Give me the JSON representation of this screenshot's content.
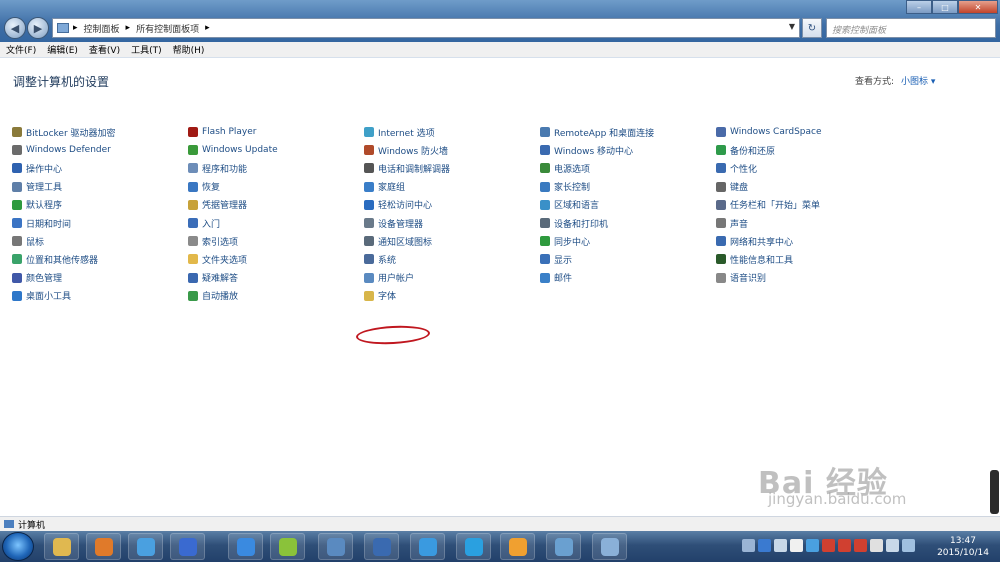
{
  "window": {
    "breadcrumb": [
      "控制面板",
      "所有控制面板项"
    ],
    "search_placeholder": "搜索控制面板",
    "buttons": {
      "minimize": "–",
      "maximize": "□",
      "close": "✕"
    }
  },
  "menu": [
    "文件(F)",
    "编辑(E)",
    "查看(V)",
    "工具(T)",
    "帮助(H)"
  ],
  "page": {
    "title": "调整计算机的设置",
    "view_by_label": "查看方式:",
    "view_by_value": "小图标 ▾"
  },
  "columns": [
    {
      "items": [
        {
          "label": "BitLocker 驱动器加密",
          "icon": "bitlocker-icon",
          "color": "#8a7a3a"
        },
        {
          "label": "Windows Defender",
          "icon": "defender-icon",
          "color": "#6b6b6b"
        },
        {
          "label": "操作中心",
          "icon": "flag-icon",
          "color": "#2f62b0"
        },
        {
          "label": "管理工具",
          "icon": "admin-tools-icon",
          "color": "#5f7fa8"
        },
        {
          "label": "默认程序",
          "icon": "default-programs-icon",
          "color": "#2e9a3e"
        },
        {
          "label": "日期和时间",
          "icon": "clock-icon",
          "color": "#3b74c4"
        },
        {
          "label": "鼠标",
          "icon": "mouse-icon",
          "color": "#777"
        },
        {
          "label": "位置和其他传感器",
          "icon": "sensor-icon",
          "color": "#3aa36a"
        },
        {
          "label": "颜色管理",
          "icon": "color-icon",
          "color": "#4058a8"
        },
        {
          "label": "桌面小工具",
          "icon": "gadgets-icon",
          "color": "#2e77c9"
        }
      ]
    },
    {
      "items": [
        {
          "label": "Flash Player",
          "icon": "flash-icon",
          "color": "#a01a14"
        },
        {
          "label": "Windows Update",
          "icon": "update-icon",
          "color": "#3a9a3a"
        },
        {
          "label": "程序和功能",
          "icon": "programs-icon",
          "color": "#6d8db8"
        },
        {
          "label": "恢复",
          "icon": "recovery-icon",
          "color": "#3a77c2"
        },
        {
          "label": "凭据管理器",
          "icon": "credential-icon",
          "color": "#c7a23a"
        },
        {
          "label": "入门",
          "icon": "getting-started-icon",
          "color": "#3b6db8"
        },
        {
          "label": "索引选项",
          "icon": "index-icon",
          "color": "#8a8a8a"
        },
        {
          "label": "文件夹选项",
          "icon": "folder-icon",
          "color": "#e2b84a"
        },
        {
          "label": "疑难解答",
          "icon": "troubleshoot-icon",
          "color": "#3a68b0"
        },
        {
          "label": "自动播放",
          "icon": "autoplay-icon",
          "color": "#3a9a4a"
        }
      ]
    },
    {
      "items": [
        {
          "label": "Internet 选项",
          "icon": "internet-icon",
          "color": "#3fa0c8"
        },
        {
          "label": "Windows 防火墙",
          "icon": "firewall-icon",
          "color": "#b04a2a"
        },
        {
          "label": "电话和调制解调器",
          "icon": "phone-icon",
          "color": "#555"
        },
        {
          "label": "家庭组",
          "icon": "homegroup-icon",
          "color": "#3a7ec8"
        },
        {
          "label": "轻松访问中心",
          "icon": "ease-access-icon",
          "color": "#2a6cc0"
        },
        {
          "label": "设备管理器",
          "icon": "device-manager-icon",
          "color": "#6a7a8a"
        },
        {
          "label": "通知区域图标",
          "icon": "notification-icon",
          "color": "#5a6a7a"
        },
        {
          "label": "系统",
          "icon": "system-icon",
          "color": "#4a6a9a"
        },
        {
          "label": "用户帐户",
          "icon": "user-accounts-icon",
          "color": "#5a8ac0"
        },
        {
          "label": "字体",
          "icon": "fonts-icon",
          "color": "#d8b64a"
        }
      ]
    },
    {
      "items": [
        {
          "label": "RemoteApp 和桌面连接",
          "icon": "remoteapp-icon",
          "color": "#4a7ab0"
        },
        {
          "label": "Windows 移动中心",
          "icon": "mobility-icon",
          "color": "#3a6ab0"
        },
        {
          "label": "电源选项",
          "icon": "power-icon",
          "color": "#3a8a3a"
        },
        {
          "label": "家长控制",
          "icon": "parental-icon",
          "color": "#3a7ac0"
        },
        {
          "label": "区域和语言",
          "icon": "region-icon",
          "color": "#3a90c8"
        },
        {
          "label": "设备和打印机",
          "icon": "printer-icon",
          "color": "#5a6a7a"
        },
        {
          "label": "同步中心",
          "icon": "sync-icon",
          "color": "#2e9a3e"
        },
        {
          "label": "显示",
          "icon": "display-icon",
          "color": "#3a70b8"
        },
        {
          "label": "邮件",
          "icon": "mail-icon",
          "color": "#3a80c8"
        }
      ]
    },
    {
      "items": [
        {
          "label": "Windows CardSpace",
          "icon": "cardspace-icon",
          "color": "#4a6aa8"
        },
        {
          "label": "备份和还原",
          "icon": "backup-icon",
          "color": "#2e9a4a"
        },
        {
          "label": "个性化",
          "icon": "personalize-icon",
          "color": "#3a6ab0"
        },
        {
          "label": "键盘",
          "icon": "keyboard-icon",
          "color": "#666"
        },
        {
          "label": "任务栏和「开始」菜单",
          "icon": "taskbar-icon",
          "color": "#5a6a8a"
        },
        {
          "label": "声音",
          "icon": "sound-icon",
          "color": "#777"
        },
        {
          "label": "网络和共享中心",
          "icon": "network-icon",
          "color": "#3a6ab0"
        },
        {
          "label": "性能信息和工具",
          "icon": "performance-icon",
          "color": "#2a5a2a"
        },
        {
          "label": "语音识别",
          "icon": "microphone-icon",
          "color": "#888"
        }
      ]
    }
  ],
  "status_bar": {
    "label": "计算机"
  },
  "taskbar": {
    "apps": [
      {
        "name": "explorer-app-icon",
        "color": "#e0b850"
      },
      {
        "name": "media-player-app-icon",
        "color": "#e07a2a"
      },
      {
        "name": "bird-app-icon",
        "color": "#4aa0e0"
      },
      {
        "name": "qq-app-icon",
        "color": "#3a6ad0"
      },
      {
        "name": "sogou-app-icon",
        "color": "#3a8ae0"
      },
      {
        "name": "green-app-icon",
        "color": "#8ac23a"
      },
      {
        "name": "movie-app-icon",
        "color": "#5a8ac0"
      },
      {
        "name": "network-app-icon",
        "color": "#3a6ab0"
      },
      {
        "name": "ie-app-icon",
        "color": "#3a9ae0"
      },
      {
        "name": "browser-app-icon",
        "color": "#2aa0e0"
      },
      {
        "name": "game-app-icon",
        "color": "#f0a030"
      },
      {
        "name": "screen-app-icon",
        "color": "#6aa0d0"
      },
      {
        "name": "control-panel-app-icon",
        "color": "#8ab0d8"
      }
    ],
    "tray": [
      {
        "name": "up-arrow-icon",
        "color": "#9ab4d4"
      },
      {
        "name": "help-icon",
        "color": "#3a7ad0"
      },
      {
        "name": "sound-tray-icon",
        "color": "#c8d8e8"
      },
      {
        "name": "windows-tray-icon",
        "color": "#f0f0f0"
      },
      {
        "name": "shield-tray-icon",
        "color": "#4aa0e0"
      },
      {
        "name": "flag-tray-icon",
        "color": "#d04030"
      },
      {
        "name": "network-tray-icon",
        "color": "#d04030"
      },
      {
        "name": "action-tray-icon",
        "color": "#d04030"
      },
      {
        "name": "ime-tray-icon",
        "color": "#e0e0e0"
      },
      {
        "name": "speaker-tray-icon",
        "color": "#c8d8e8"
      },
      {
        "name": "tray-app-icon",
        "color": "#a0c0e0"
      }
    ],
    "time": "13:47",
    "date": "2015/10/14"
  },
  "watermark": {
    "line1": "Bai 经验",
    "line2": "jingyan.baidu.com"
  }
}
